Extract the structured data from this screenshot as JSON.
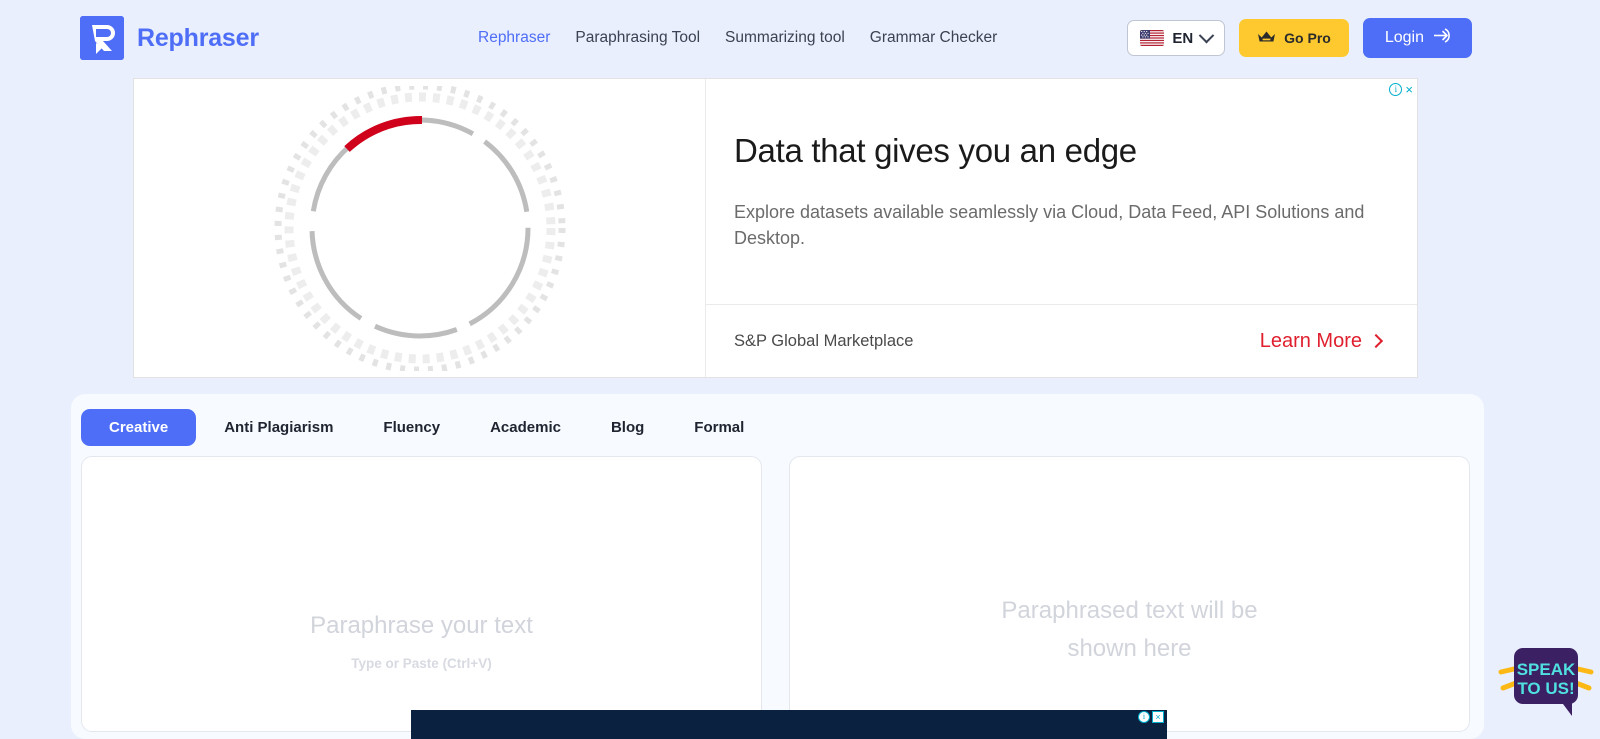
{
  "brand": {
    "name": "Rephraser",
    "logo_icon": "rephraser-r-speech-bubble-logo",
    "accent": "#4f6ef7"
  },
  "nav": {
    "items": [
      {
        "label": "Rephraser",
        "active": true
      },
      {
        "label": "Paraphrasing Tool",
        "active": false
      },
      {
        "label": "Summarizing tool",
        "active": false
      },
      {
        "label": "Grammar Checker",
        "active": false
      }
    ]
  },
  "header_actions": {
    "language": {
      "code": "EN",
      "flag_icon": "us-flag-icon",
      "chevron_icon": "chevron-down-icon"
    },
    "go_pro": {
      "label": "Go Pro",
      "icon": "crown-icon",
      "color": "#fdc92f"
    },
    "login": {
      "label": "Login",
      "icon": "login-arrow-icon",
      "color": "#4f6ef7"
    }
  },
  "ad": {
    "graphic_icon": "dashed-circle-gauge-graphic",
    "title": "Data that gives you an edge",
    "body": "Explore datasets available seamlessly via Cloud, Data Feed, API Solutions and Desktop.",
    "advertiser": "S&P Global Marketplace",
    "cta": "Learn More",
    "cta_arrow_icon": "chevron-right-icon",
    "cta_color": "#e01f2e",
    "info_icon": "ad-info-icon",
    "close_icon": "ad-close-icon",
    "close_label": "×"
  },
  "tool": {
    "tabs": [
      {
        "label": "Creative",
        "active": true
      },
      {
        "label": "Anti Plagiarism",
        "active": false
      },
      {
        "label": "Fluency",
        "active": false
      },
      {
        "label": "Academic",
        "active": false
      },
      {
        "label": "Blog",
        "active": false
      },
      {
        "label": "Formal",
        "active": false
      }
    ],
    "input_pane": {
      "placeholder_title": "Paraphrase your text",
      "placeholder_hint": "Type or Paste (Ctrl+V)",
      "value": ""
    },
    "output_pane": {
      "placeholder_title": "Paraphrased text will be shown here",
      "value": ""
    }
  },
  "widgets": {
    "speak_to_us": {
      "line1": "SPEAK",
      "line2": "TO US!",
      "bubble_color": "#3b2063",
      "text_color": "#4fe0df"
    }
  },
  "bottom_ad": {
    "info_icon": "ad-info-icon",
    "close_icon": "ad-close-icon",
    "close_label": "×",
    "background": "#0a2140"
  }
}
